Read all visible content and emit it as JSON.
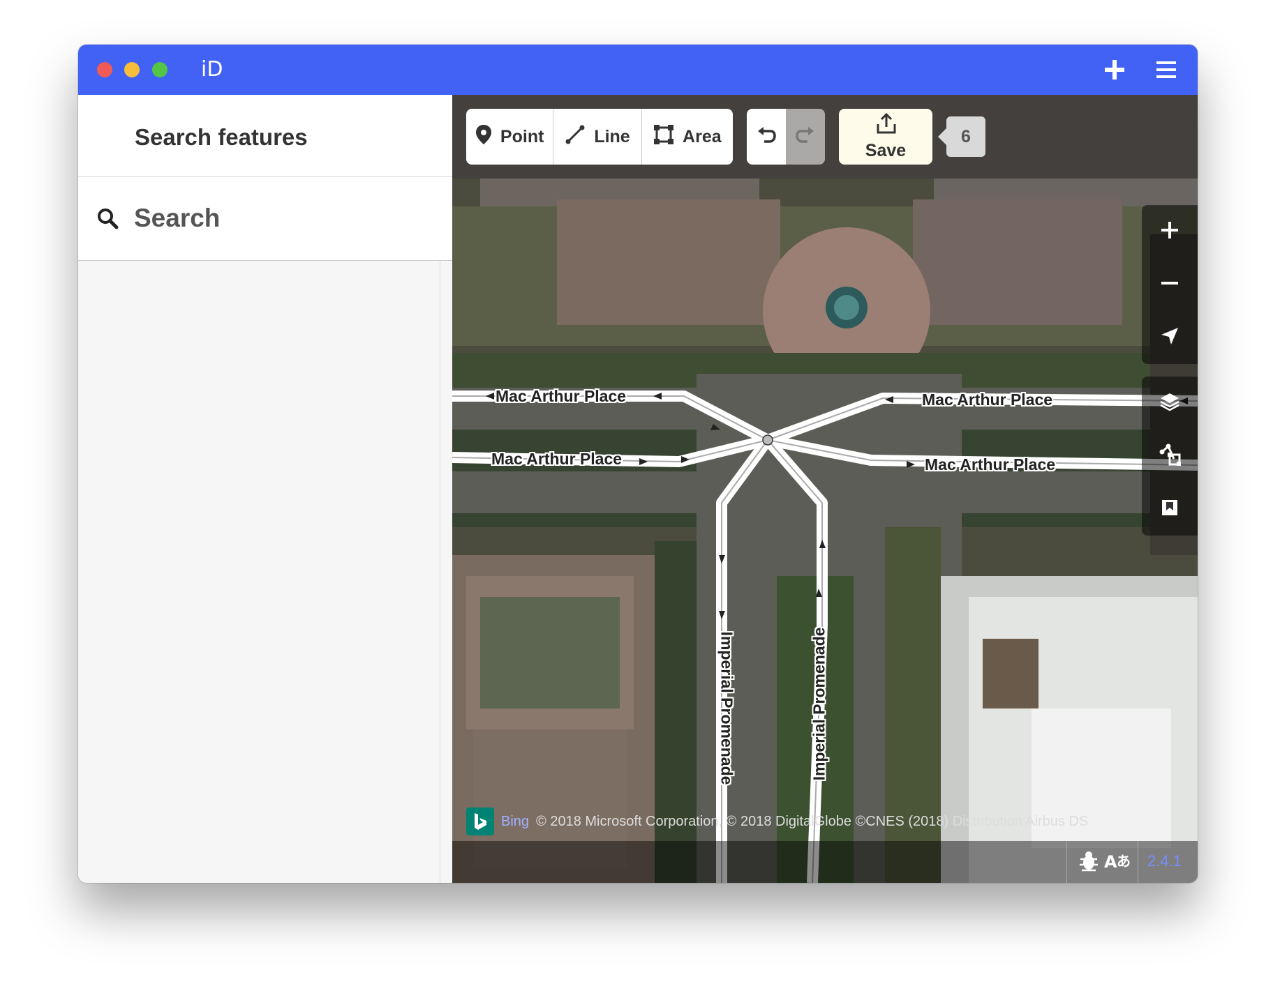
{
  "window": {
    "title": "iD"
  },
  "titlebar": {
    "icons": [
      "plus-icon",
      "hamburger-menu-icon"
    ]
  },
  "sidebar": {
    "title": "Search features",
    "search": {
      "placeholder": "Search",
      "value": ""
    }
  },
  "toolbar": {
    "modes": [
      {
        "label": "Point",
        "icon": "point-marker-icon"
      },
      {
        "label": "Line",
        "icon": "line-icon"
      },
      {
        "label": "Area",
        "icon": "area-icon"
      }
    ],
    "undo_icon": "undo-icon",
    "redo_icon": "redo-icon",
    "save_label": "Save",
    "edit_count": "6"
  },
  "map": {
    "road_labels": {
      "mac_arthur_1": "Mac Arthur Place",
      "mac_arthur_2": "Mac Arthur Place",
      "mac_arthur_3": "Mac Arthur Place",
      "mac_arthur_4": "Mac Arthur Place",
      "imperial_1": "Imperial Promenade",
      "imperial_2": "Imperial Promenade"
    },
    "controls": [
      "zoom-in-icon",
      "zoom-out-icon",
      "geolocate-icon",
      "layers-icon",
      "map-data-icon",
      "help-icon"
    ],
    "attribution": {
      "provider": "Bing",
      "text": "© 2018 Microsoft Corporation, © 2018 DigitalGlobe ©CNES (2018) Distribution Airbus DS"
    },
    "footer": {
      "version": "2.4.1",
      "icons": [
        "bug-icon",
        "translate-icon"
      ]
    }
  },
  "colors": {
    "titlebar": "#4262f5",
    "save_button": "#fffbea",
    "version_text": "#7a8cff"
  }
}
